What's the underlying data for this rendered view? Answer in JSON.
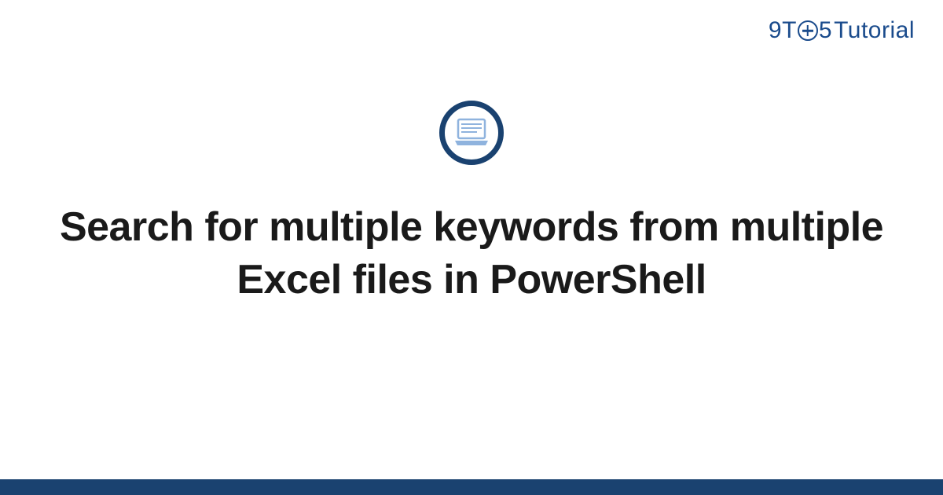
{
  "logo": {
    "part1": "9",
    "part2": "T",
    "part3": "5",
    "part4": "Tutorial"
  },
  "title": "Search for multiple keywords from multiple Excel files in PowerShell",
  "colors": {
    "brand_blue": "#1a4b8c",
    "dark_blue": "#1a4270",
    "light_blue": "#8fb3de"
  }
}
